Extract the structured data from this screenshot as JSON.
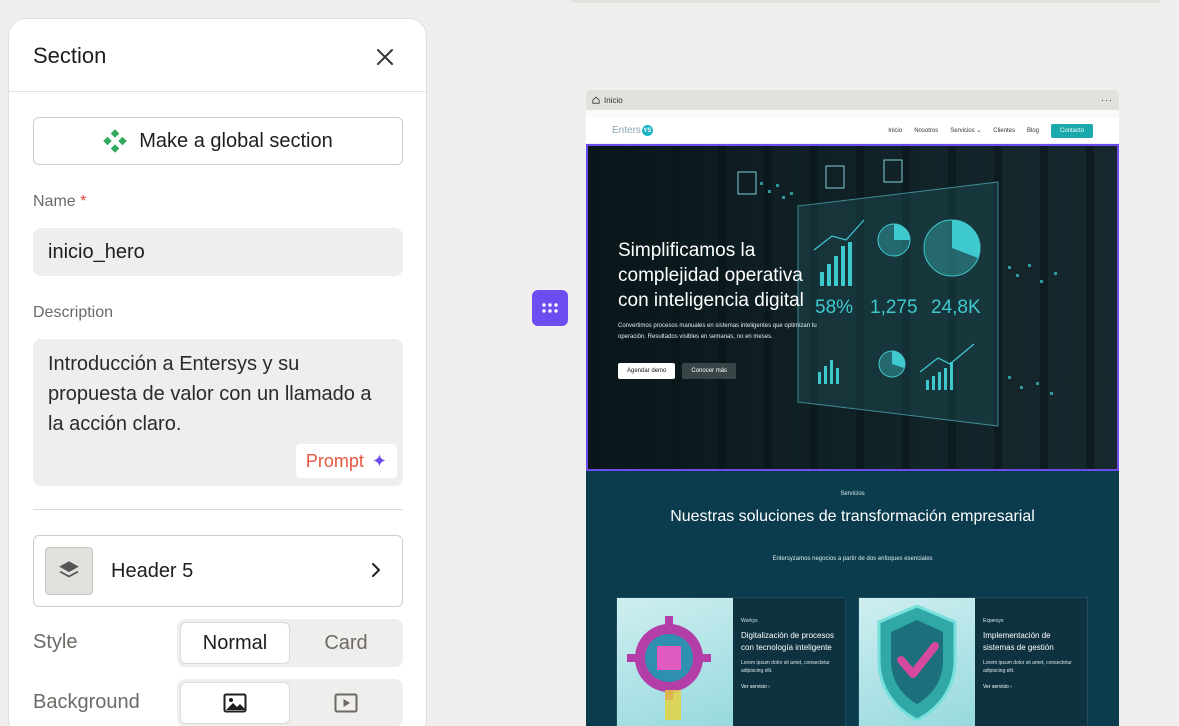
{
  "panel": {
    "title": "Section",
    "global_button": "Make a global section",
    "name_label": "Name",
    "required_mark": "*",
    "name_value": "inicio_hero",
    "description_label": "Description",
    "description_value": "Introducción a Entersys y su propuesta de valor con un llamado a la acción claro.",
    "prompt_button": "Prompt",
    "header_component": "Header 5",
    "style_label": "Style",
    "style_options": [
      "Normal",
      "Card"
    ],
    "style_selected": "Normal",
    "background_label": "Background",
    "background_options": [
      "image-icon",
      "video-icon"
    ],
    "background_selected": "image-icon"
  },
  "preview": {
    "browser_tab": "Inicio",
    "browser_menu": "···",
    "logo_text": "Enters",
    "logo_mark": "YS",
    "nav": [
      "Inicio",
      "Nosotros",
      "Servicios",
      "Clientes",
      "Blog"
    ],
    "nav_dropdown_chevron": "⌄",
    "nav_cta": "Contacto",
    "hero": {
      "title": "Simplificamos la complejidad operativa con inteligencia digital",
      "subtitle": "Convertimos procesos manuales en sistemas inteligentes que optimizan tu operación. Resultados visibles en semanas, no en meses.",
      "primary_button": "Agendar demo",
      "secondary_button": "Conocer más",
      "stats": [
        "58%",
        "1,275",
        "24,8K"
      ]
    },
    "services": {
      "eyebrow": "Servicios",
      "title": "Nuestras soluciones de transformación empresarial",
      "subtitle": "Entersyzamos negocios a partir de dos enfoques esenciales",
      "cards": [
        {
          "kicker": "Workys",
          "name": "Digitalización de procesos con tecnología inteligente",
          "desc": "Lorem ipsum dolor sit amet, consectetur adipiscing elit.",
          "link": "Ver servicio  ›"
        },
        {
          "kicker": "Expersys",
          "name": "Implementación de sistemas de gestión",
          "desc": "Lorem ipsum dolor sit amet, consectetur adipiscing elit.",
          "link": "Ver servicio  ›"
        }
      ]
    }
  },
  "colors": {
    "accent": "#6d4df2",
    "prompt": "#e8553f",
    "cta": "#1ba8ad",
    "required": "#e0463a"
  }
}
